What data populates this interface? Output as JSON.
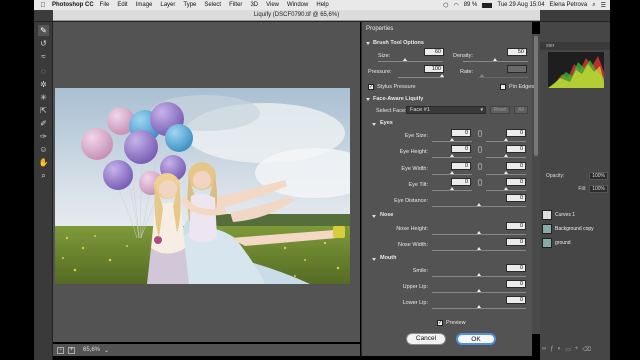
{
  "menubar": {
    "app_name": "Photoshop CC",
    "items": [
      "File",
      "Edit",
      "Image",
      "Layer",
      "Type",
      "Select",
      "Filter",
      "3D",
      "View",
      "Window",
      "Help"
    ],
    "battery": "89 %",
    "datetime": "Tue 29 Aug  15:04",
    "user": "Elena Petrova"
  },
  "liquify": {
    "title": "Liquify (DSCF0790.tif @ 65,6%)",
    "zoom_level": "65,6%",
    "status_minus": "−",
    "status_plus": "+"
  },
  "properties": {
    "title": "Properties",
    "brush_tool_options": {
      "heading": "Brush Tool Options",
      "size_label": "Size:",
      "size_value": "60",
      "density_label": "Density:",
      "density_value": "50",
      "pressure_label": "Pressure:",
      "pressure_value": "100",
      "rate_label": "Rate:",
      "rate_value": "",
      "stylus_pressure_label": "Stylus Pressure",
      "pin_edges_label": "Pin Edges"
    },
    "face_aware": {
      "heading": "Face-Aware Liquify",
      "select_face_label": "Select Face:",
      "select_face_value": "Face #1",
      "reset_label": "Reset",
      "all_label": "All"
    },
    "eyes": {
      "heading": "Eyes",
      "rows": [
        {
          "label": "Eye Size:",
          "left": "0",
          "right": "0"
        },
        {
          "label": "Eye Height:",
          "left": "0",
          "right": "0"
        },
        {
          "label": "Eye Width:",
          "left": "0",
          "right": "0"
        },
        {
          "label": "Eye Tilt:",
          "left": "0",
          "right": "0"
        }
      ],
      "distance_label": "Eye Distance:",
      "distance_value": "0"
    },
    "nose": {
      "heading": "Nose",
      "rows": [
        {
          "label": "Nose Height:",
          "value": "0"
        },
        {
          "label": "Nose Width:",
          "value": "0"
        }
      ]
    },
    "mouth": {
      "heading": "Mouth",
      "rows": [
        {
          "label": "Smile:",
          "value": "0"
        },
        {
          "label": "Upper Lip:",
          "value": "0"
        },
        {
          "label": "Lower Lip:",
          "value": "0"
        }
      ]
    },
    "preview_label": "Preview",
    "cancel_label": "Cancel",
    "ok_label": "OK"
  },
  "ps_panels": {
    "tab_fragment": "ster",
    "opacity_label": "Opacity:",
    "opacity_value": "100%",
    "fill_label": "Fill:",
    "fill_value": "100%",
    "layers": [
      "Curves 1",
      "Background copy",
      "ground"
    ]
  },
  "colors": {
    "panel_bg": "#535353",
    "ok_ring": "#4f8fe6",
    "app_dark": "#3a3a3a"
  }
}
